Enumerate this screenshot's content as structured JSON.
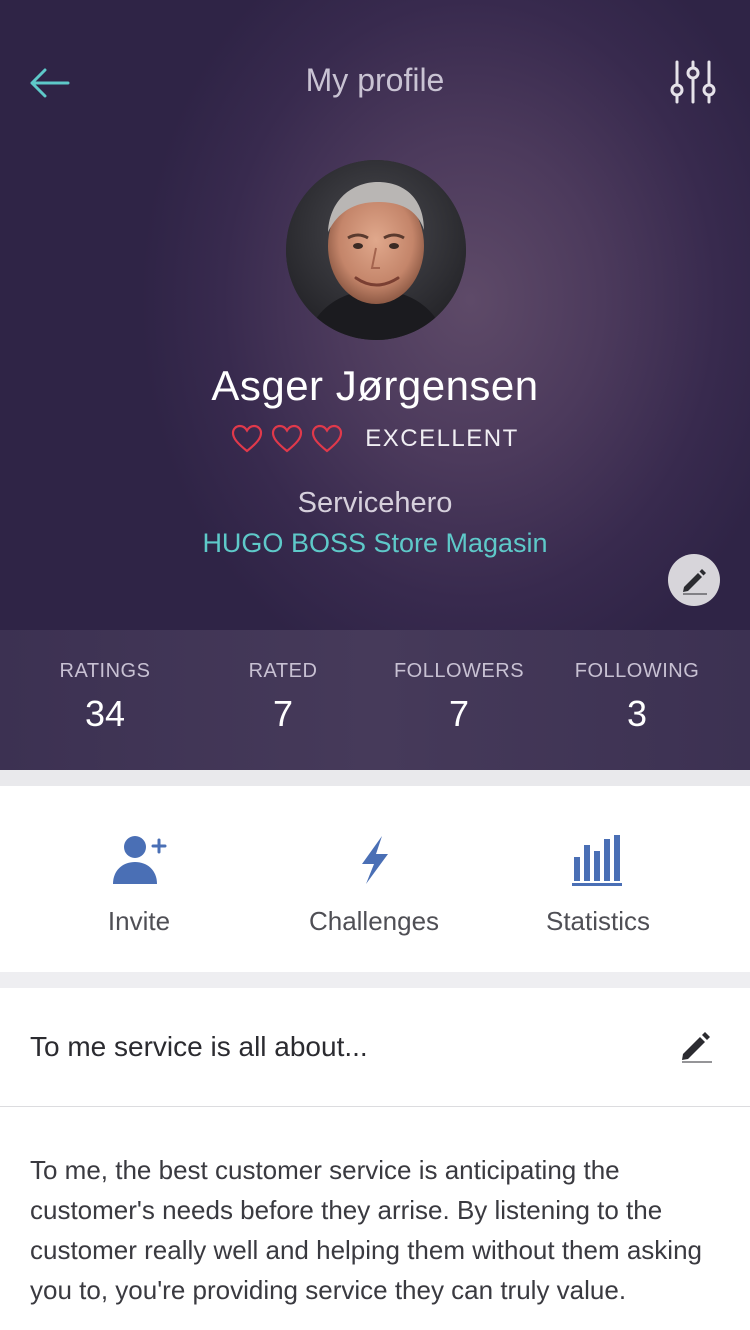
{
  "header": {
    "title": "My profile",
    "back_icon": "arrow-left-icon",
    "filter_icon": "sliders-icon",
    "accent_color": "#5ec9c9"
  },
  "profile": {
    "name": "Asger Jørgensen",
    "rating_hearts": 3,
    "rating_label": "EXCELLENT",
    "role": "Servicehero",
    "store": "HUGO BOSS Store Magasin",
    "heart_color": "#e0394b"
  },
  "stats": [
    {
      "label": "RATINGS",
      "value": "34"
    },
    {
      "label": "RATED",
      "value": "7"
    },
    {
      "label": "FOLLOWERS",
      "value": "7"
    },
    {
      "label": "FOLLOWING",
      "value": "3"
    }
  ],
  "actions": [
    {
      "label": "Invite",
      "icon": "add-user-icon"
    },
    {
      "label": "Challenges",
      "icon": "lightning-icon"
    },
    {
      "label": "Statistics",
      "icon": "bar-chart-icon"
    }
  ],
  "about": {
    "title": "To me service is all about...",
    "text": "To me, the best customer service is anticipating the customer's needs before they arrise. By listening to the customer really well and helping them without them asking you to, you're providing service they can truly value."
  },
  "colors": {
    "icon_blue": "#4a6fb5"
  }
}
